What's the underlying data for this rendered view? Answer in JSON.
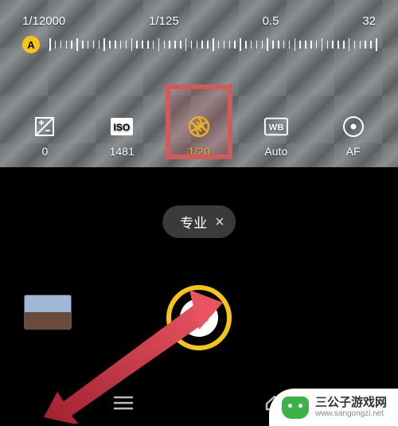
{
  "scale": {
    "labels": [
      "1/12000",
      "1/125",
      "0.5",
      "32"
    ],
    "badge": "A"
  },
  "params": [
    {
      "key": "ev",
      "value": "0",
      "icon": "exposure-comp-icon",
      "active": false
    },
    {
      "key": "iso",
      "value": "1481",
      "icon": "iso-icon",
      "active": false
    },
    {
      "key": "shutter",
      "value": "1/20",
      "icon": "aperture-icon",
      "active": true
    },
    {
      "key": "wb",
      "value": "Auto",
      "icon": "white-balance-icon",
      "active": false
    },
    {
      "key": "af",
      "value": "AF",
      "icon": "focus-icon",
      "active": false
    }
  ],
  "mode": {
    "label": "专业",
    "close_aria": "close"
  },
  "watermark": {
    "title": "三公子游戏网",
    "url": "www.sangongzi.net"
  },
  "nav": {
    "menu": "menu",
    "home": "home"
  }
}
